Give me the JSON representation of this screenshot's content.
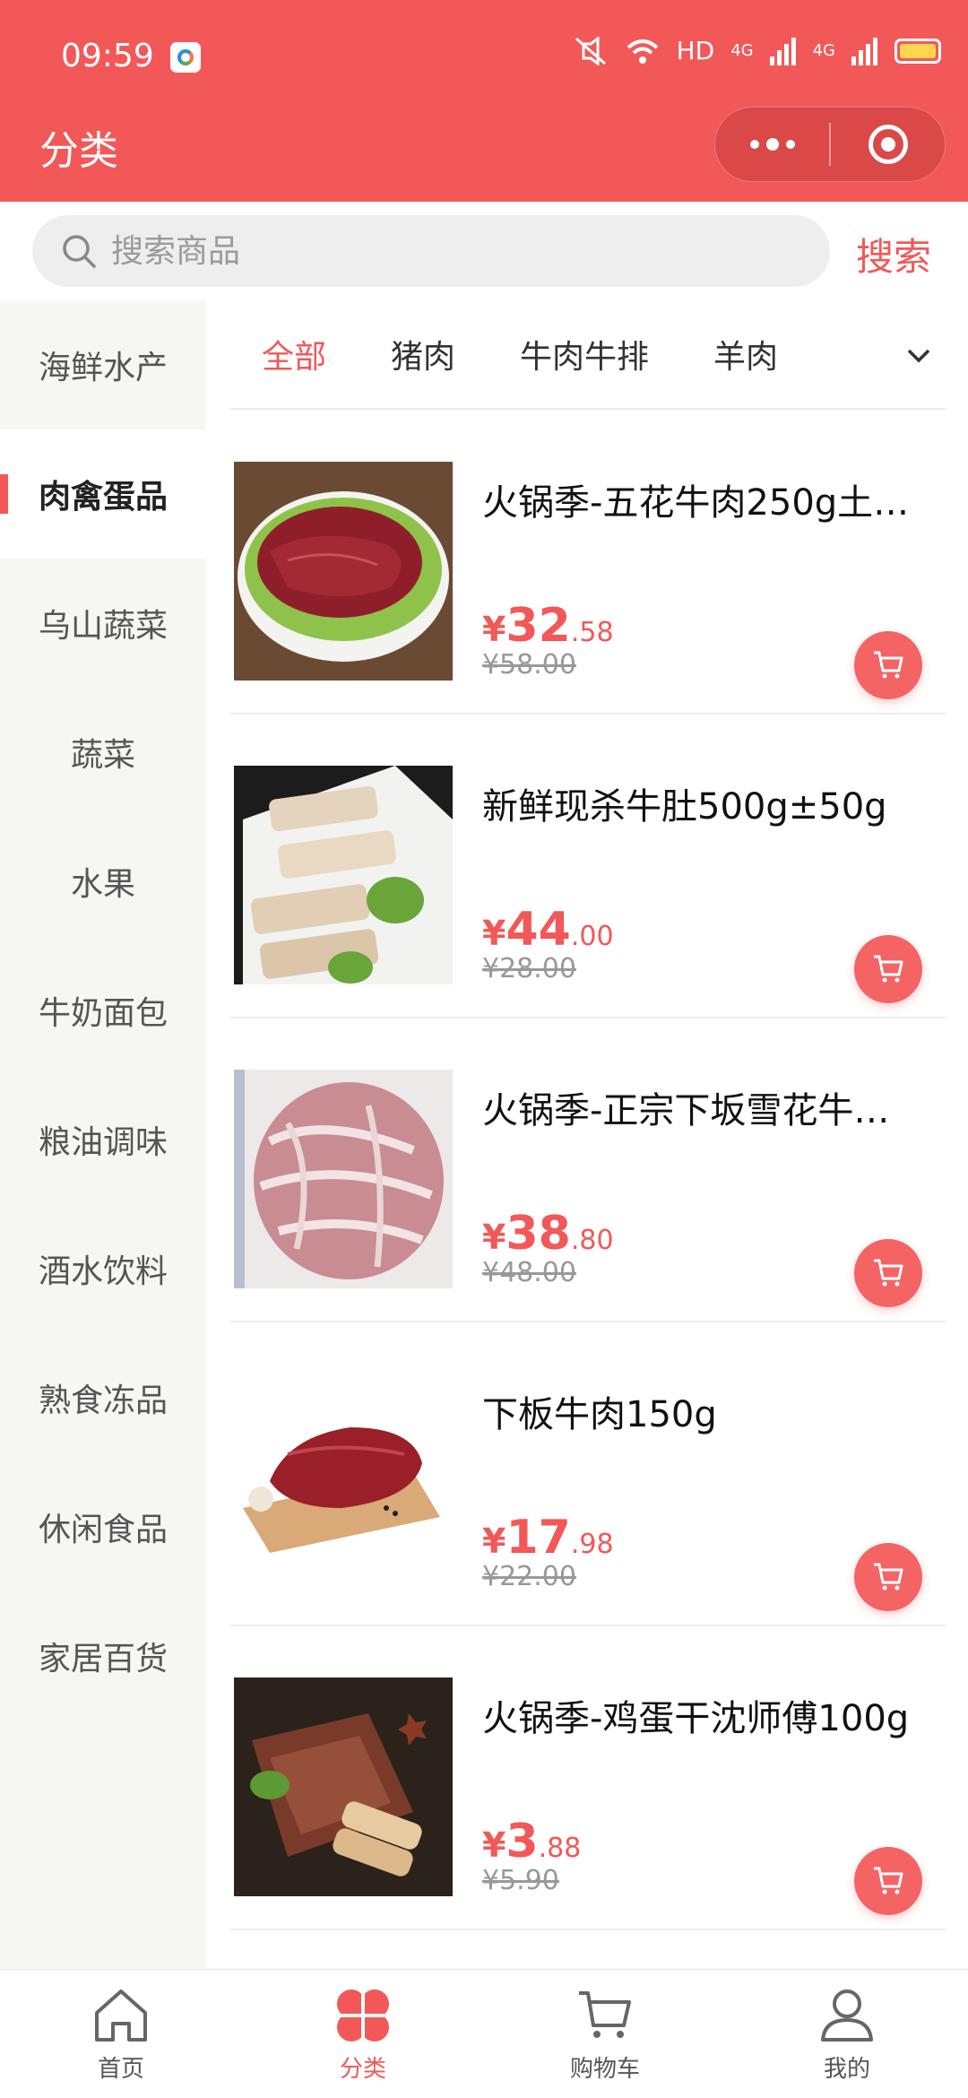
{
  "status_bar": {
    "time": "09:59",
    "network": "HD",
    "signal_1": "4G",
    "signal_2": "4G"
  },
  "nav": {
    "title": "分类"
  },
  "search": {
    "placeholder": "搜索商品",
    "button_label": "搜索"
  },
  "sidebar": {
    "items": [
      {
        "label": "海鲜水产"
      },
      {
        "label": "肉禽蛋品",
        "active": true
      },
      {
        "label": "乌山蔬菜"
      },
      {
        "label": "蔬菜"
      },
      {
        "label": "水果"
      },
      {
        "label": "牛奶面包"
      },
      {
        "label": "粮油调味"
      },
      {
        "label": "酒水饮料"
      },
      {
        "label": "熟食冻品"
      },
      {
        "label": "休闲食品"
      },
      {
        "label": "家居百货"
      }
    ]
  },
  "category_tabs": [
    {
      "label": "全部",
      "active": true
    },
    {
      "label": "猪肉"
    },
    {
      "label": "牛肉牛排"
    },
    {
      "label": "羊肉"
    }
  ],
  "products": [
    {
      "name": "火锅季-五花牛肉250g土…",
      "currency": "¥",
      "price_int": "32",
      "price_dec": ".58",
      "original_price": "¥58.00",
      "image": "sliced-beef-on-lettuce"
    },
    {
      "name": "新鲜现杀牛肚500g±50g",
      "currency": "¥",
      "price_int": "44",
      "price_dec": ".00",
      "original_price": "¥28.00",
      "image": "beef-tripe-on-plate"
    },
    {
      "name": "火锅季-正宗下坂雪花牛…",
      "currency": "¥",
      "price_int": "38",
      "price_dec": ".80",
      "original_price": "¥48.00",
      "image": "marbled-beef-slices"
    },
    {
      "name": "下板牛肉150g",
      "currency": "¥",
      "price_int": "17",
      "price_dec": ".98",
      "original_price": "¥22.00",
      "image": "beef-block-on-board"
    },
    {
      "name": "火锅季-鸡蛋干沈师傅100g",
      "currency": "¥",
      "price_int": "3",
      "price_dec": ".88",
      "original_price": "¥5.90",
      "image": "egg-tofu-slices"
    }
  ],
  "tabbar": [
    {
      "label": "首页",
      "icon": "home-icon"
    },
    {
      "label": "分类",
      "icon": "category-icon",
      "active": true
    },
    {
      "label": "购物车",
      "icon": "cart-icon"
    },
    {
      "label": "我的",
      "icon": "profile-icon"
    }
  ],
  "colors": {
    "brand": "#f25858",
    "sidebar_bg": "#f6f6f4",
    "battery": "#ffd54f"
  }
}
